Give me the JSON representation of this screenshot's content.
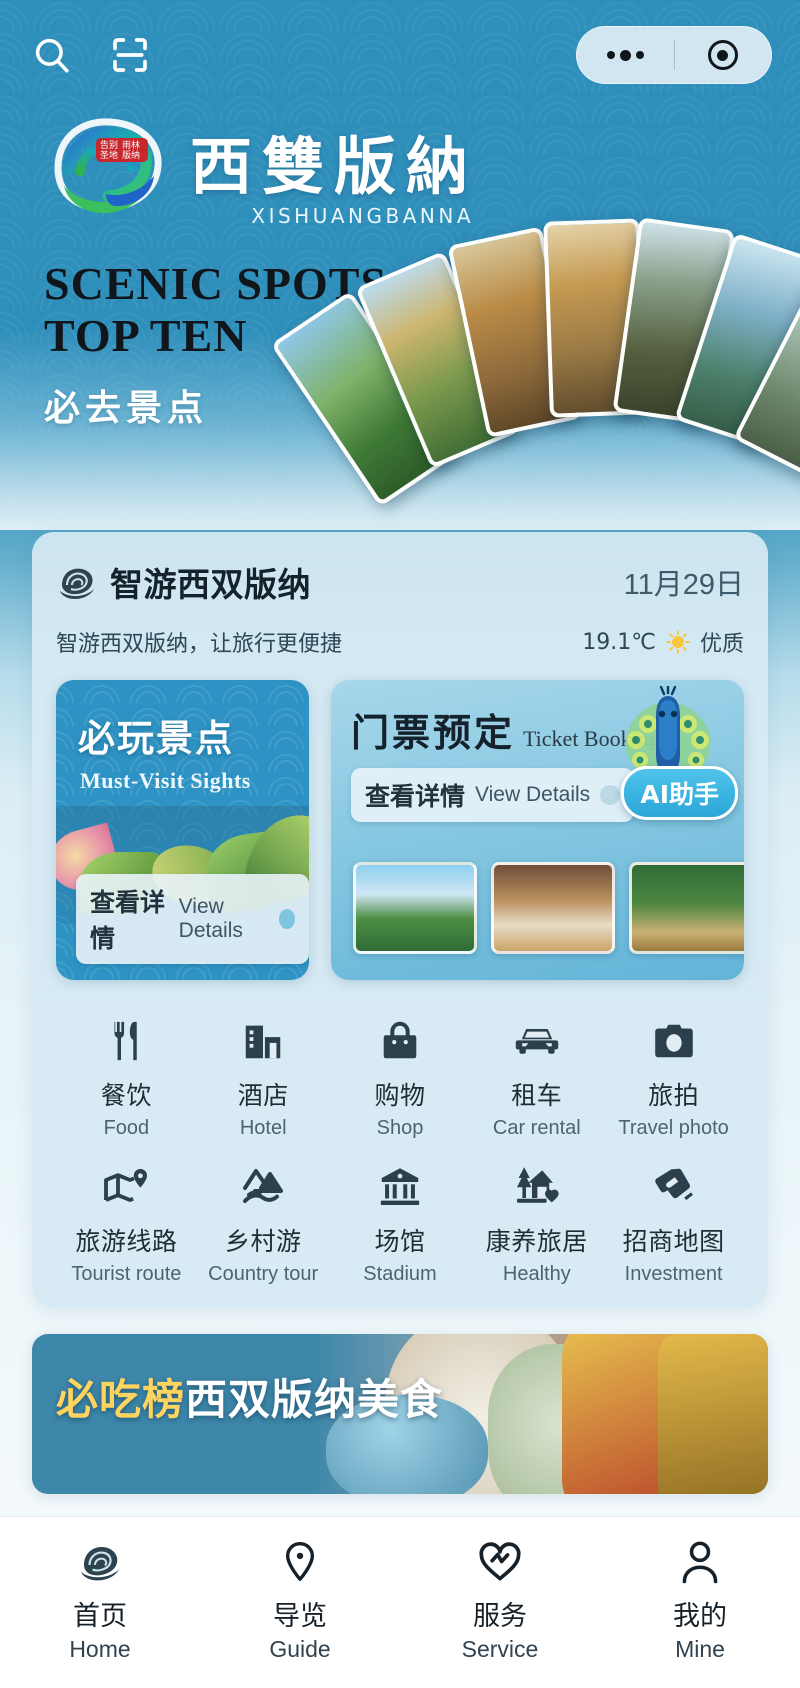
{
  "topbar": {
    "search_icon": "search-icon",
    "scan_icon": "scan-icon",
    "menu_dots_icon": "more-dots-icon",
    "target_icon": "target-circle-icon"
  },
  "hero": {
    "brand_cn": "西雙版納",
    "brand_en": "XISHUANGBANNA",
    "title_line1": "SCENIC SPOTS",
    "title_line2": "TOP TEN",
    "subtitle_cn": "必去景点",
    "logo_icon": "xishuangbanna-peacock-logo"
  },
  "card": {
    "logo_icon": "app-rose-logo",
    "title": "智游西双版纳",
    "date": "11月29日",
    "subtitle": "智游西双版纳，让旅行更便捷",
    "weather": {
      "temperature": "19.1℃",
      "icon": "sun-icon",
      "air_quality": "优质"
    },
    "features": [
      {
        "cn": "必玩景点",
        "en": "Must-Visit Sights",
        "button_cn": "查看详情",
        "button_en": "View Details",
        "arrow_icon": "arrow-right-icon"
      },
      {
        "cn": "门票预定",
        "en": "Ticket Booking",
        "button_cn": "查看详情",
        "button_en": "View Details",
        "arrow_icon": "arrow-right-icon",
        "badge": "AI助手",
        "badge_icon": "peacock-icon"
      }
    ],
    "grid": [
      {
        "cn": "餐饮",
        "en": "Food",
        "icon": "fork-knife-icon"
      },
      {
        "cn": "酒店",
        "en": "Hotel",
        "icon": "building-icon"
      },
      {
        "cn": "购物",
        "en": "Shop",
        "icon": "shopping-bag-icon"
      },
      {
        "cn": "租车",
        "en": "Car rental",
        "icon": "car-icon"
      },
      {
        "cn": "旅拍",
        "en": "Travel photo",
        "icon": "camera-icon"
      },
      {
        "cn": "旅游线路",
        "en": "Tourist route",
        "icon": "map-pin-icon"
      },
      {
        "cn": "乡村游",
        "en": "Country tour",
        "icon": "mountain-icon"
      },
      {
        "cn": "场馆",
        "en": "Stadium",
        "icon": "museum-icon"
      },
      {
        "cn": "康养旅居",
        "en": "Healthy",
        "icon": "house-tree-heart-icon"
      },
      {
        "cn": "招商地图",
        "en": "Investment",
        "icon": "handshake-icon"
      }
    ]
  },
  "food_banner": {
    "highlight": "必吃榜",
    "rest": "西双版纳美食"
  },
  "tabbar": [
    {
      "cn": "首页",
      "en": "Home",
      "icon": "rose-home-icon",
      "active": true
    },
    {
      "cn": "导览",
      "en": "Guide",
      "icon": "map-pin-icon",
      "active": false
    },
    {
      "cn": "服务",
      "en": "Service",
      "icon": "heart-service-icon",
      "active": false
    },
    {
      "cn": "我的",
      "en": "Mine",
      "icon": "person-icon",
      "active": false
    }
  ],
  "colors": {
    "brand_blue": "#2f8fbb",
    "card_bg": "#d6eaf3",
    "accent": "#2ba6d8",
    "text_dark": "#16212a",
    "highlight_yellow": "#ffd45e"
  }
}
